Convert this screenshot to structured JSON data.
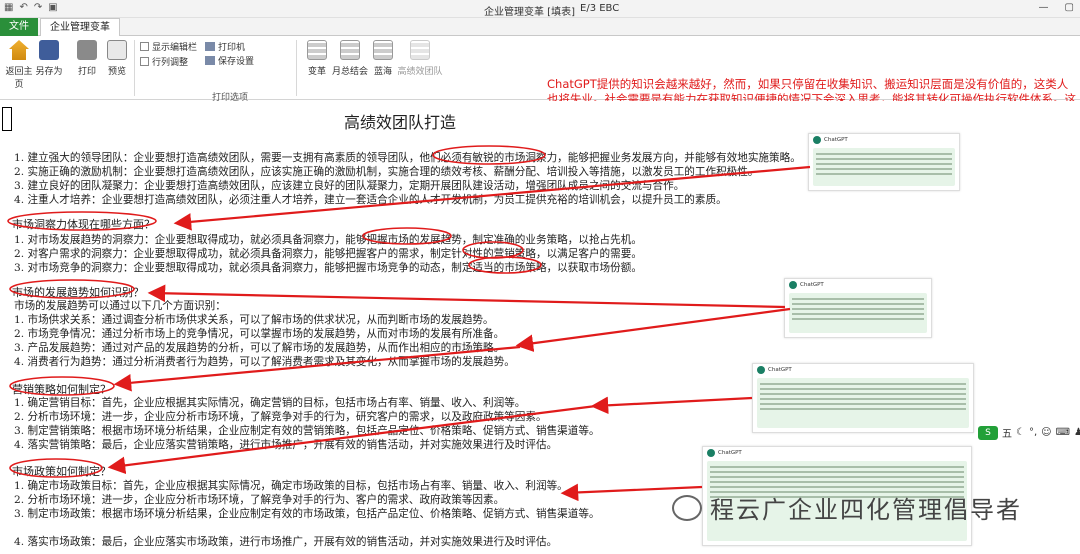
{
  "window": {
    "title": "企业管理变革 [填表]",
    "subtitle": "E/3 EBC"
  },
  "tabs": {
    "file": "文件",
    "active": "企业管理变革"
  },
  "ribbon": {
    "home": "返回主页",
    "save_as": "另存为",
    "print": "打印",
    "preview": "预览",
    "show_edit_bar": "显示编辑栏",
    "row_adjust": "行列调整",
    "print_small": "打印机",
    "save_settings": "保存设置",
    "print_options": "打印选项",
    "reform": "变革",
    "monthly": "月总结会",
    "bluesea": "蓝海",
    "high_perf": "高绩效团队"
  },
  "note": "ChatGPT提供的知识会越来越好，然而，如果只停留在收集知识、搬运知识层面是没有价值的，这类人也将失业。社会需要是有能力在获取知识便捷的情况下会深入思考，能将其转化可操作执行软件体系。这类人才将是企业最为需要的，我们的\"万人万企\"计划，就在培养这类人才。",
  "doc": {
    "title": "高绩效团队打造",
    "intro": [
      "1. 建立强大的领导团队：企业要想打造高绩效团队，需要一支拥有高素质的领导团队，他们必须有敏锐的市场洞察力，能够把握业务发展方向，并能够有效地实施策略。",
      "2. 实施正确的激励机制：企业要想打造高绩效团队，应该实施正确的激励机制，实施合理的绩效考核、薪酬分配、培训投入等措施，以激发员工的工作积极性。",
      "3. 建立良好的团队凝聚力：企业要想打造高绩效团队，应该建立良好的团队凝聚力，定期开展团队建设活动，增强团队成员之间的交流与合作。",
      "4. 注重人才培养：企业要想打造高绩效团队，必须注重人才培养，建立一套适合企业的人才开发机制，为员工提供充裕的培训机会，以提升员工的素质。"
    ],
    "h1": "市场洞察力体现在哪些方面？",
    "s1": [
      "1. 对市场发展趋势的洞察力：企业要想取得成功，就必须具备洞察力，能够把握市场的发展趋势，制定准确的业务策略，以抢占先机。",
      "2. 对客户需求的洞察力：企业要想取得成功，就必须具备洞察力，能够把握客户的需求，制定针对性的营销策略，以满足客户的需要。",
      "3. 对市场竞争的洞察力：企业要想取得成功，就必须具备洞察力，能够把握市场竞争的动态，制定适当的市场策略，以获取市场份额。"
    ],
    "h2": "市场的发展趋势如何识别？",
    "s2_intro": [
      "市场的发展趋势如何识别？",
      "市场的发展趋势可以通过以下几个方面识别："
    ],
    "s2": [
      "1.  市场供求关系：通过调查分析市场供求关系，可以了解市场的供求状况，从而判断市场的发展趋势。",
      "2.  市场竞争情况：通过分析市场上的竞争情况，可以掌握市场的发展趋势，从而对市场的发展有所准备。",
      "3.  产品发展趋势：通过对产品的发展趋势的分析，可以了解市场的发展趋势，从而作出相应的市场策略。",
      "4.  消费者行为趋势：通过分析消费者行为趋势，可以了解消费者需求及其变化，从而掌握市场的发展趋势。"
    ],
    "h3": "营销策略如何制定？",
    "s3": [
      "1.  确定营销目标：首先，企业应根据其实际情况，确定营销的目标，包括市场占有率、销量、收入、利润等。",
      "2.  分析市场环境：进一步，企业应分析市场环境，了解竞争对手的行为，研究客户的需求，以及政府政策等因素。",
      "3.  制定营销策略：根据市场环境分析结果，企业应制定有效的营销策略，包括产品定位、价格策略、促销方式、销售渠道等。",
      "4.  落实营销策略：最后，企业应落实营销策略，进行市场推广，开展有效的销售活动，并对实施效果进行及时评估。"
    ],
    "h4": "市场政策如何制定？",
    "s4": [
      "1.  确定市场政策目标：首先，企业应根据其实际情况，确定市场政策的目标，包括市场占有率、销量、收入、利润等。",
      "2.  分析市场环境：进一步，企业应分析市场环境，了解竞争对手的行为、客户的需求、政府政策等因素。",
      "3.  制定市场政策：根据市场环境分析结果，企业应制定有效的市场政策，包括产品定位、价格策略、促销方式、销售渠道等。",
      "4.  落实市场政策：最后，企业应落实市场政策，进行市场推广，开展有效的销售活动，并对实施效果进行及时评估。"
    ]
  },
  "thumbs": {
    "label": "ChatGPT"
  },
  "ime": {
    "logo": "S",
    "text": "五"
  },
  "watermark": "程云广企业四化管理倡导者",
  "colors": {
    "note": "#e01b1b",
    "accent": "#2a8f3a"
  }
}
